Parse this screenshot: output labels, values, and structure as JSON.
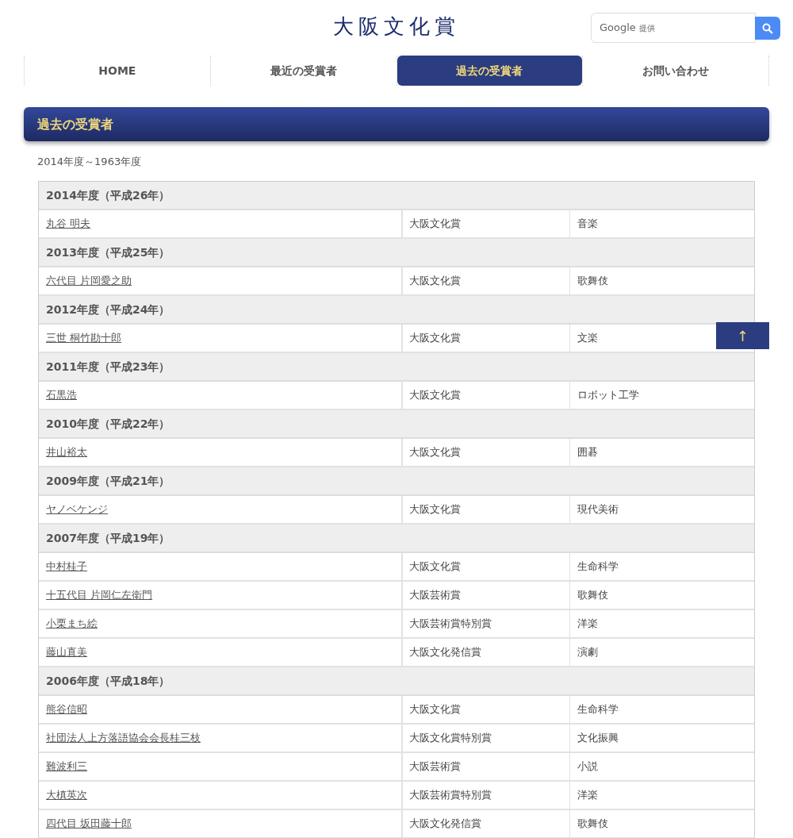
{
  "logo": "大阪文化賞",
  "search": {
    "placeholder_brand": "Google",
    "placeholder_note": "提供"
  },
  "nav": [
    {
      "label": "HOME",
      "selected": false
    },
    {
      "label": "最近の受賞者",
      "selected": false
    },
    {
      "label": "過去の受賞者",
      "selected": true
    },
    {
      "label": "お問い合わせ",
      "selected": false
    }
  ],
  "section_title": "過去の受賞者",
  "range": "2014年度～1963年度",
  "years": [
    {
      "year": "2014年度（平成26年）",
      "winners": [
        {
          "name": "丸谷 明夫",
          "award": "大阪文化賞",
          "field": "音楽"
        }
      ]
    },
    {
      "year": "2013年度（平成25年）",
      "winners": [
        {
          "name": "六代目 片岡愛之助",
          "award": "大阪文化賞",
          "field": "歌舞伎"
        }
      ]
    },
    {
      "year": "2012年度（平成24年）",
      "winners": [
        {
          "name": "三世 桐竹勘十郎",
          "award": "大阪文化賞",
          "field": "文楽"
        }
      ]
    },
    {
      "year": "2011年度（平成23年）",
      "winners": [
        {
          "name": "石黒浩",
          "award": "大阪文化賞",
          "field": "ロボット工学"
        }
      ]
    },
    {
      "year": "2010年度（平成22年）",
      "winners": [
        {
          "name": "井山裕太",
          "award": "大阪文化賞",
          "field": "囲碁"
        }
      ]
    },
    {
      "year": "2009年度（平成21年）",
      "winners": [
        {
          "name": "ヤノベケンジ",
          "award": "大阪文化賞",
          "field": "現代美術"
        }
      ]
    },
    {
      "year": "2007年度（平成19年）",
      "winners": [
        {
          "name": "中村桂子",
          "award": "大阪文化賞",
          "field": "生命科学"
        },
        {
          "name": "十五代目 片岡仁左衛門",
          "award": "大阪芸術賞",
          "field": "歌舞伎"
        },
        {
          "name": "小栗まち絵",
          "award": "大阪芸術賞特別賞",
          "field": "洋楽"
        },
        {
          "name": "藤山直美",
          "award": "大阪文化発信賞",
          "field": "演劇"
        }
      ]
    },
    {
      "year": "2006年度（平成18年）",
      "winners": [
        {
          "name": "熊谷信昭",
          "award": "大阪文化賞",
          "field": "生命科学"
        },
        {
          "name": "社団法人上方落語協会会長桂三枝",
          "award": "大阪文化賞特別賞",
          "field": "文化振興"
        },
        {
          "name": "難波利三",
          "award": "大阪芸術賞",
          "field": "小説"
        },
        {
          "name": "大槙英次",
          "award": "大阪芸術賞特別賞",
          "field": "洋楽"
        },
        {
          "name": "四代目 坂田藤十郎",
          "award": "大阪文化発信賞",
          "field": "歌舞伎"
        }
      ]
    }
  ],
  "back_to_top": "↑"
}
